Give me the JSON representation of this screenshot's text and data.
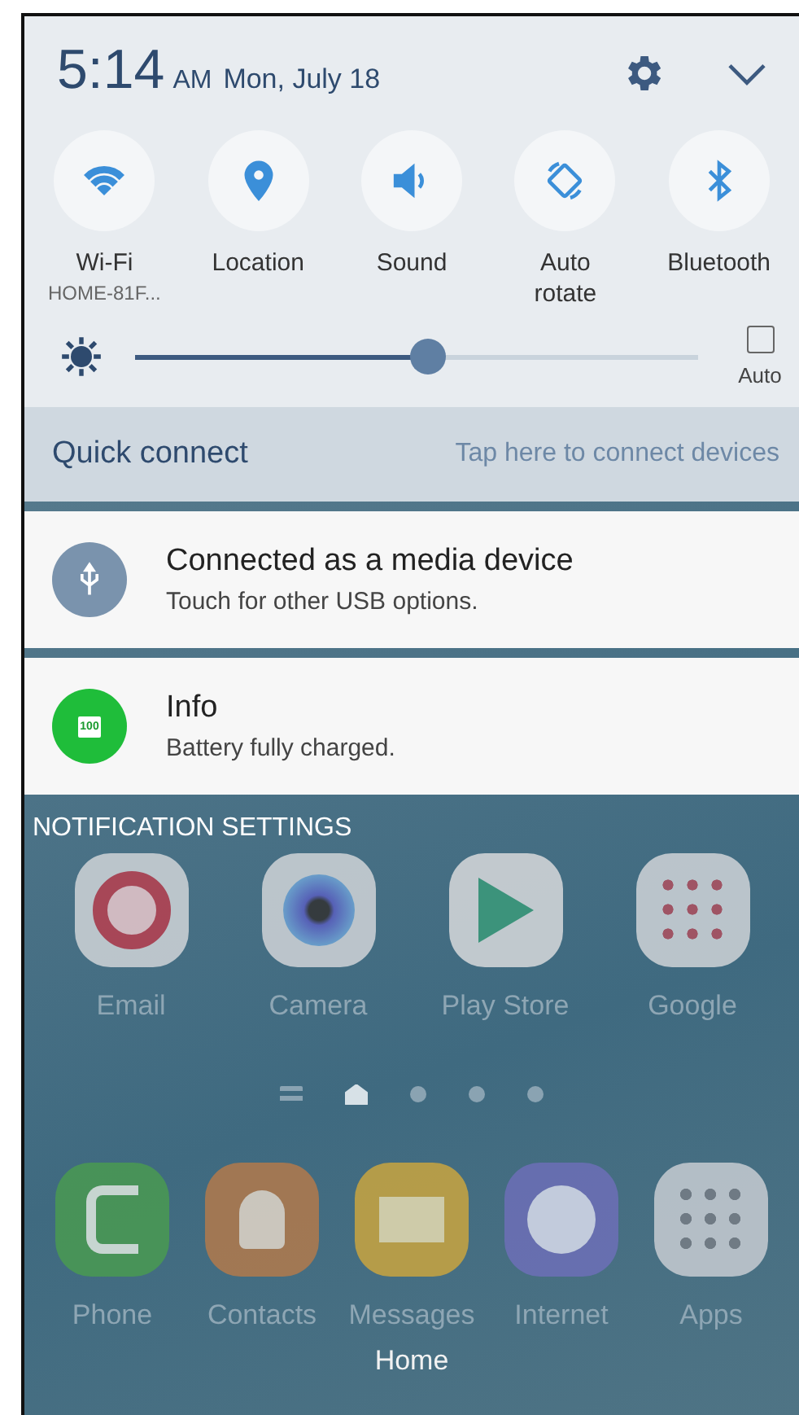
{
  "header": {
    "time": "5:14",
    "ampm": "AM",
    "date": "Mon, July 18"
  },
  "toggles": [
    {
      "kind": "wifi",
      "label": "Wi-Fi",
      "sublabel": "HOME-81F...",
      "on": true
    },
    {
      "kind": "location",
      "label": "Location",
      "on": true
    },
    {
      "kind": "sound",
      "label": "Sound",
      "on": true
    },
    {
      "kind": "rotate",
      "label": "Auto rotate",
      "on": true
    },
    {
      "kind": "bluetooth",
      "label": "Bluetooth",
      "on": true
    }
  ],
  "brightness": {
    "level": 0.52,
    "auto_label": "Auto",
    "auto_checked": false
  },
  "quick_connect": {
    "title": "Quick connect",
    "hint": "Tap here to connect devices"
  },
  "notifications": [
    {
      "kind": "usb",
      "title": "Connected as a media device",
      "text": "Touch for other USB options."
    },
    {
      "kind": "battery",
      "title": "Info",
      "text": "Battery fully charged.",
      "badge": "100"
    }
  ],
  "notification_settings": "NOTIFICATION SETTINGS",
  "home_screen": {
    "apps": [
      {
        "kind": "email",
        "label": "Email"
      },
      {
        "kind": "camera",
        "label": "Camera"
      },
      {
        "kind": "store",
        "label": "Play Store"
      },
      {
        "kind": "folder",
        "label": "Google"
      }
    ],
    "page_indicator": [
      {
        "kind": "list",
        "selected": false
      },
      {
        "kind": "home",
        "selected": true
      },
      {
        "kind": "dot",
        "selected": false
      },
      {
        "kind": "dot",
        "selected": false
      },
      {
        "kind": "dot",
        "selected": false
      }
    ],
    "dock": [
      {
        "kind": "phone",
        "label": "Phone"
      },
      {
        "kind": "contacts",
        "label": "Contacts"
      },
      {
        "kind": "messages",
        "label": "Messages"
      },
      {
        "kind": "internet",
        "label": "Internet"
      },
      {
        "kind": "apps",
        "label": "Apps"
      }
    ],
    "home_label": "Home"
  }
}
